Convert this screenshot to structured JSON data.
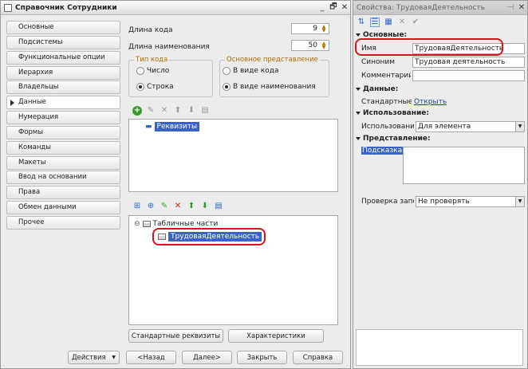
{
  "left_window": {
    "title": "Справочник Сотрудники",
    "controls": [
      "_",
      "🗗",
      "✕"
    ],
    "nav": [
      "Основные",
      "Подсистемы",
      "Функциональные опции",
      "Иерархия",
      "Владельцы",
      "Данные",
      "Нумерация",
      "Формы",
      "Команды",
      "Макеты",
      "Ввод на основании",
      "Права",
      "Обмен данными",
      "Прочее"
    ],
    "nav_active_index": 5,
    "code_length_label": "Длина кода",
    "code_length_value": "9",
    "name_length_label": "Длина наименования",
    "name_length_value": "50",
    "code_type": {
      "legend": "Тип кода",
      "options": [
        "Число",
        "Строка"
      ],
      "selected": "Строка"
    },
    "main_repr": {
      "legend": "Основное представление",
      "options": [
        "В виде кода",
        "В виде наименования"
      ],
      "selected": "В виде наименования"
    },
    "attributes_tree": {
      "root_label": "Реквизиты"
    },
    "tabular_tree": {
      "root_label": "Табличные части",
      "child_label": "ТрудоваяДеятельность"
    },
    "btn_standard_attrs": "Стандартные реквизиты",
    "btn_characteristics": "Характеристики",
    "footer": {
      "actions": "Действия",
      "back": "<Назад",
      "next": "Далее>",
      "close": "Закрыть",
      "help": "Справка"
    }
  },
  "right_window": {
    "title": "Свойства: ТрудоваяДеятельность",
    "sections": {
      "basic": "Основные:",
      "data": "Данные:",
      "usage": "Использование:",
      "presentation": "Представление:"
    },
    "props": {
      "name_label": "Имя",
      "name_value": "ТрудоваяДеятельность",
      "synonym_label": "Синоним",
      "synonym_value": "Трудовая деятельность",
      "comment_label": "Комментарий",
      "comment_value": "",
      "std_attrs_label": "Стандартные р",
      "std_attrs_link": "Открыть",
      "usage_label": "Использования",
      "usage_value": "Для элемента",
      "hint_label": "Подсказка",
      "check_label": "Проверка запо",
      "check_value": "Не проверять"
    }
  },
  "colors": {
    "selection": "#3b63c7",
    "highlight_ring": "#d9131c",
    "legend_text": "#b46a00"
  }
}
